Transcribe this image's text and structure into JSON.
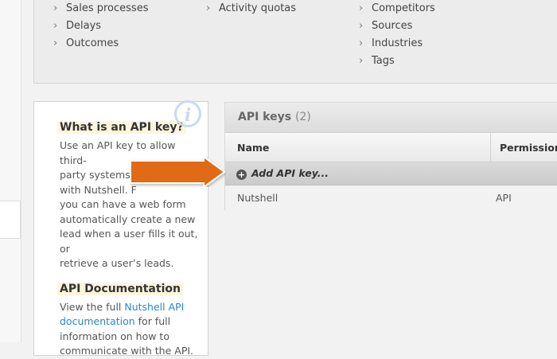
{
  "settings": {
    "col1": [
      "Sales processes",
      "Delays",
      "Outcomes"
    ],
    "col2": [
      "Activity quotas"
    ],
    "col3": [
      "Competitors",
      "Sources",
      "Industries",
      "Tags"
    ]
  },
  "help": {
    "heading1": "What is an API key?",
    "text1_line1": "Use an API key to allow third-",
    "text1_line2": "party systems t",
    "text1_line3": "with Nutshell. F",
    "text1_line4": "you can have a web form",
    "text1_line5": "automatically create a new",
    "text1_line6": "lead when a user fills it out, or",
    "text1_line7": "retrieve a user’s leads.",
    "heading2": "API Documentation",
    "text2_pre": "View the full ",
    "text2_link1": "Nutshell API",
    "text2_link2": "documentation",
    "text2_post": " for full",
    "text2_line3": "information on how to",
    "text2_line4": "communicate with the API.",
    "info_glyph": "i"
  },
  "api_keys": {
    "title": "API keys",
    "count": "(2)",
    "columns": {
      "name": "Name",
      "permission": "Permission"
    },
    "add_label": "Add API key...",
    "rows": [
      {
        "name": "Nutshell",
        "permission": "API"
      }
    ]
  },
  "icons": {
    "chevron": "chevron-right-icon",
    "plus": "plus-circle-icon",
    "info": "info-icon"
  },
  "colors": {
    "arrow": "#e06a12",
    "link": "#2b86c9",
    "highlight": "#fbf6dc"
  }
}
